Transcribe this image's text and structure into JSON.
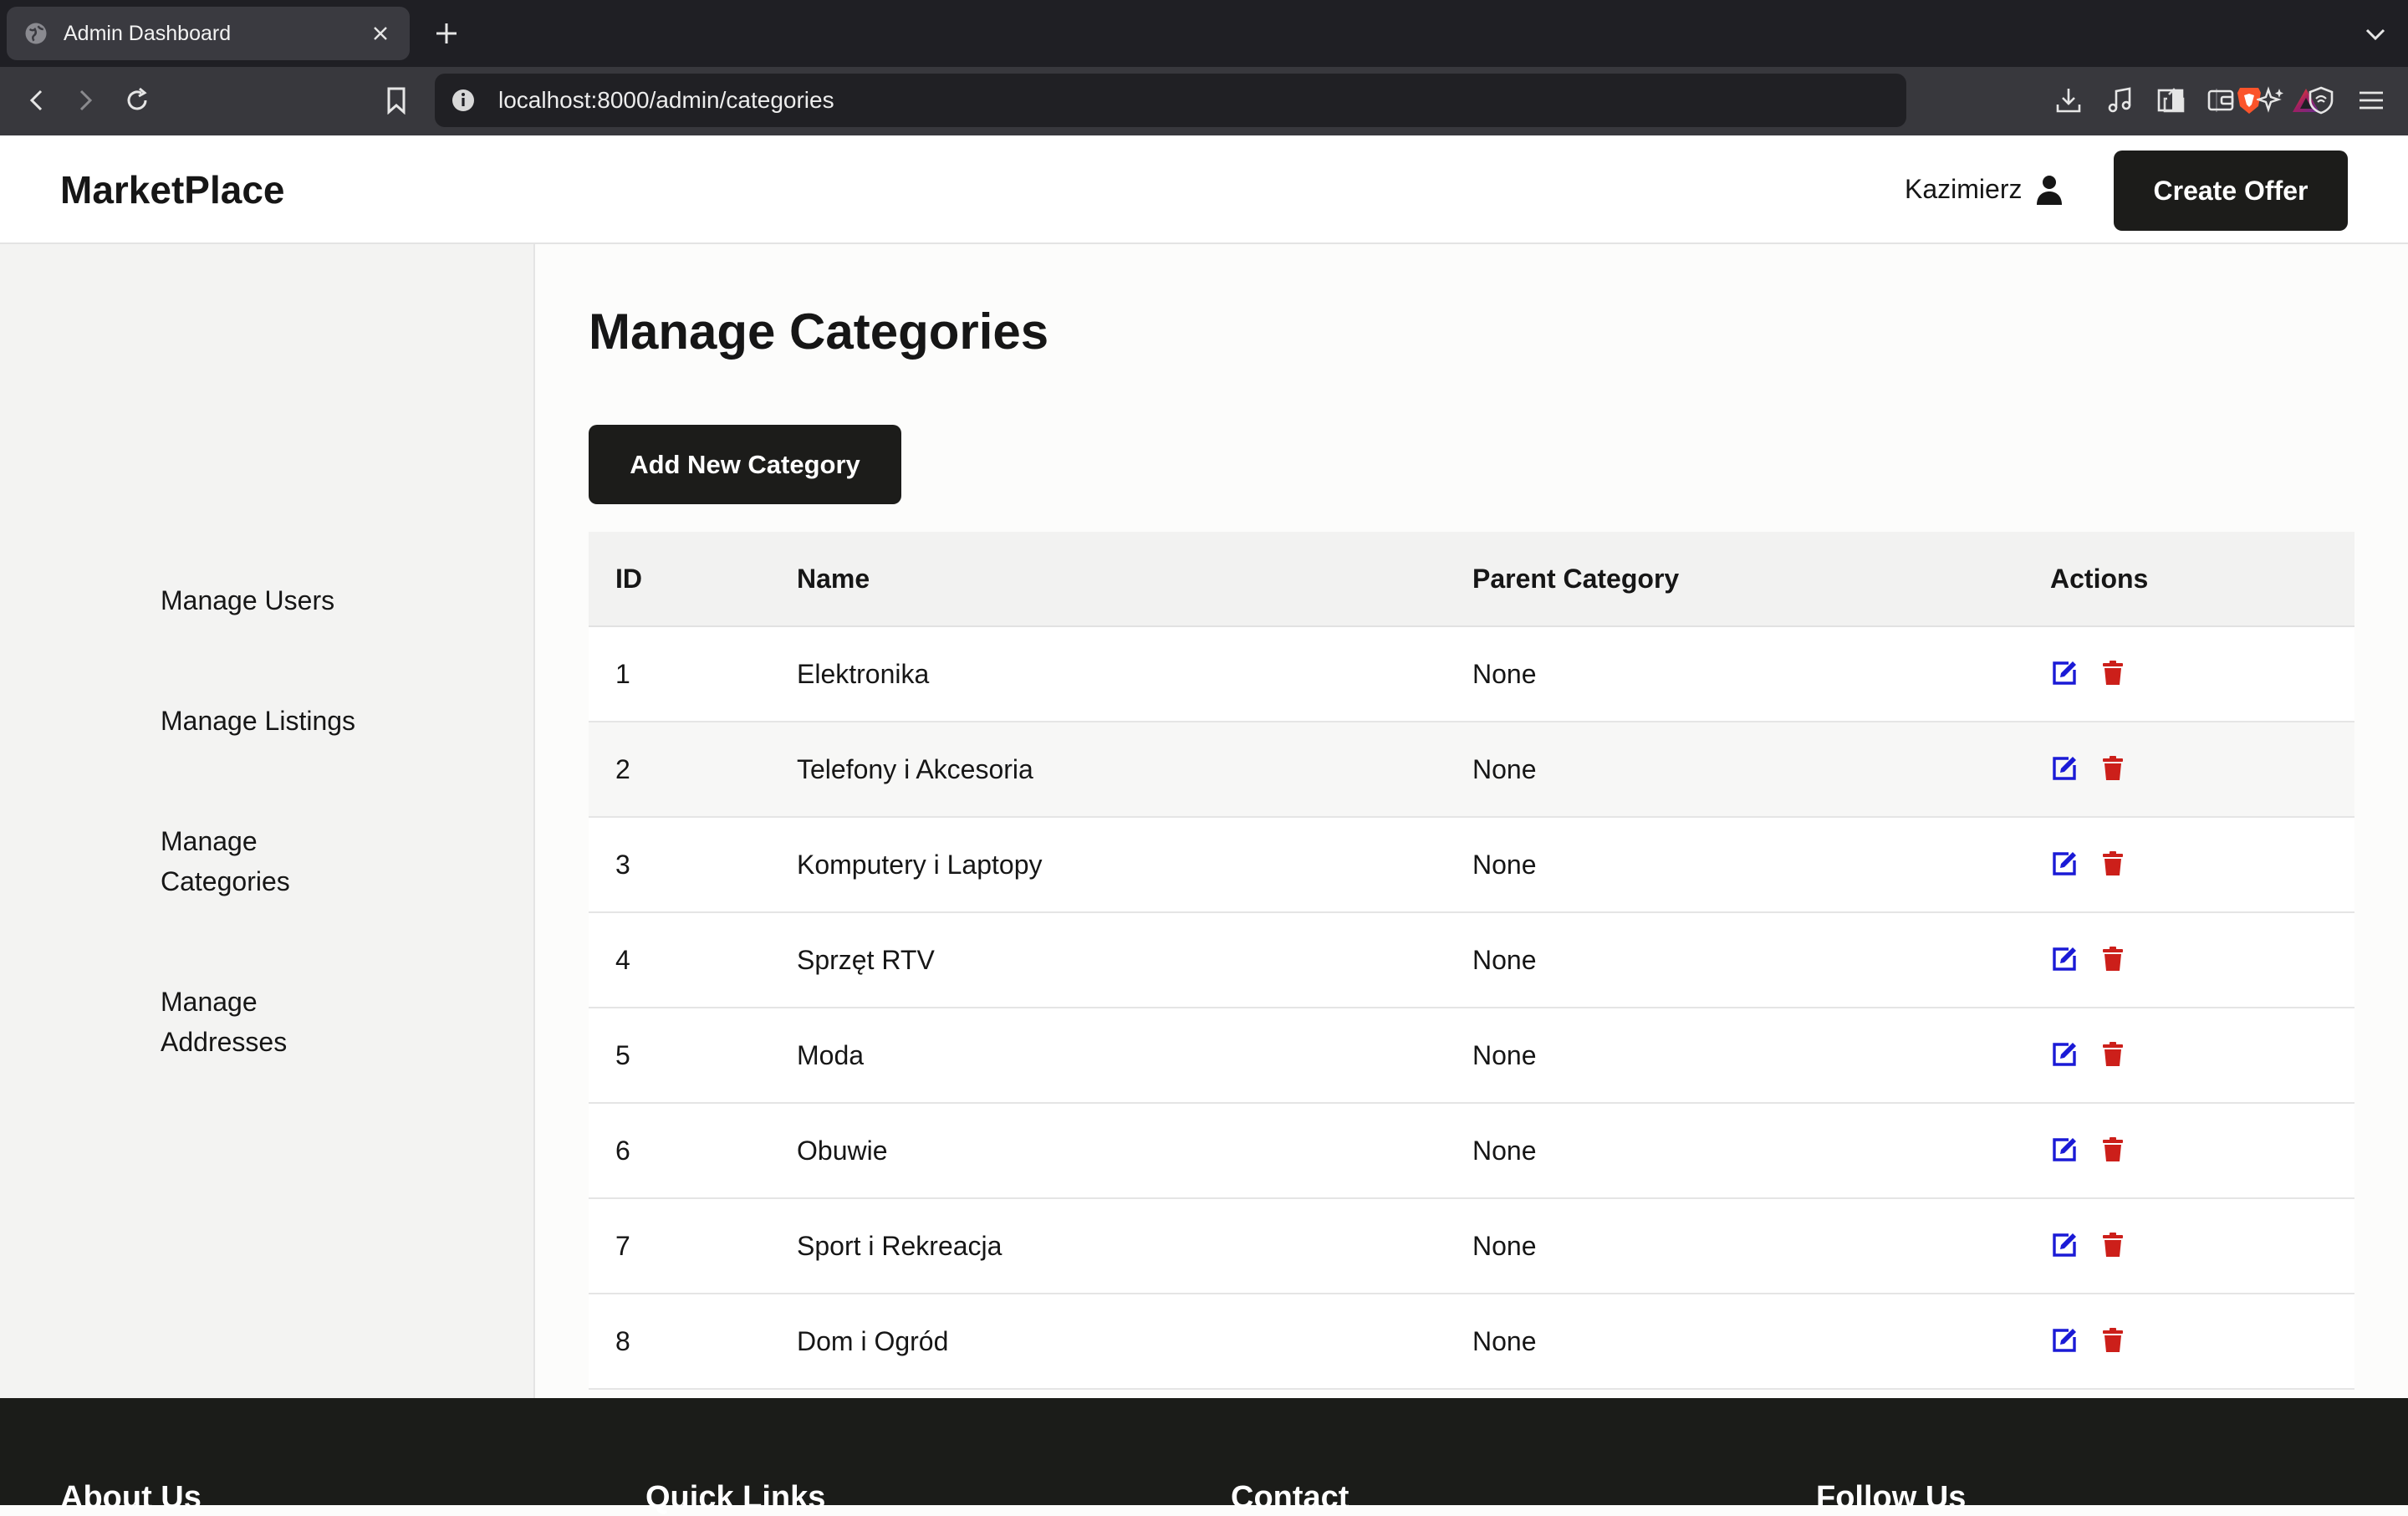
{
  "browser": {
    "tab_title": "Admin Dashboard",
    "url": "localhost:8000/admin/categories"
  },
  "header": {
    "logo": "MarketPlace",
    "user_name": "Kazimierz",
    "create_offer_label": "Create Offer"
  },
  "sidebar": {
    "items": [
      {
        "label": "Manage Users"
      },
      {
        "label": "Manage Listings"
      },
      {
        "label": "Manage Categories"
      },
      {
        "label": "Manage Addresses"
      }
    ]
  },
  "main": {
    "title": "Manage Categories",
    "add_button_label": "Add New Category",
    "table": {
      "headers": {
        "id": "ID",
        "name": "Name",
        "parent": "Parent Category",
        "actions": "Actions"
      },
      "rows": [
        {
          "id": "1",
          "name": "Elektronika",
          "parent": "None"
        },
        {
          "id": "2",
          "name": "Telefony i Akcesoria",
          "parent": "None"
        },
        {
          "id": "3",
          "name": "Komputery i Laptopy",
          "parent": "None"
        },
        {
          "id": "4",
          "name": "Sprzęt RTV",
          "parent": "None"
        },
        {
          "id": "5",
          "name": "Moda",
          "parent": "None"
        },
        {
          "id": "6",
          "name": "Obuwie",
          "parent": "None"
        },
        {
          "id": "7",
          "name": "Sport i Rekreacja",
          "parent": "None"
        },
        {
          "id": "8",
          "name": "Dom i Ogród",
          "parent": "None"
        }
      ]
    }
  },
  "footer": {
    "columns": [
      {
        "heading": "About Us"
      },
      {
        "heading": "Quick Links"
      },
      {
        "heading": "Contact"
      },
      {
        "heading": "Follow Us"
      }
    ]
  },
  "colors": {
    "edit_icon": "#1a1ad6",
    "delete_icon": "#cc1f1a",
    "primary_button": "#1c1c1a"
  },
  "icons": {
    "edit": "edit-icon",
    "delete": "trash-icon"
  }
}
